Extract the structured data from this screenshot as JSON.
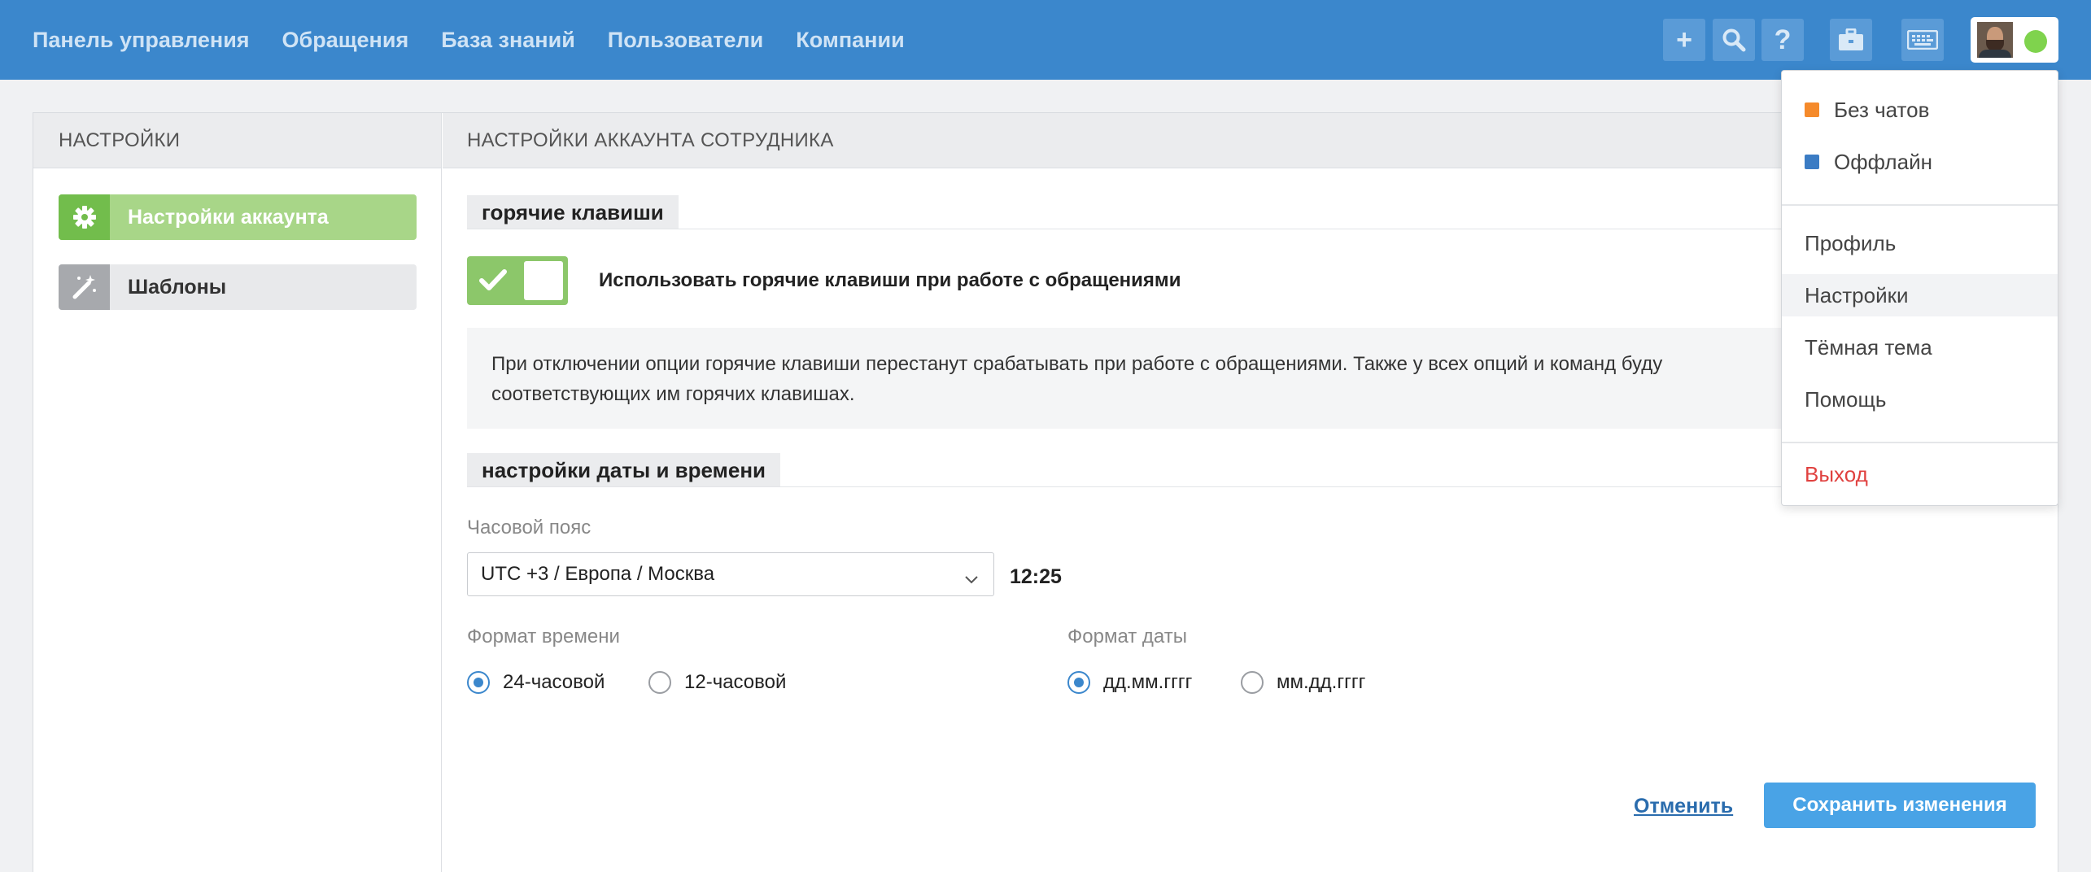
{
  "topnav": {
    "items": [
      "Панель управления",
      "Обращения",
      "База знаний",
      "Пользователи",
      "Компании"
    ]
  },
  "toolbar": {
    "icons": [
      "plus-icon",
      "search-icon",
      "help-icon",
      "briefcase-icon",
      "keyboard-icon"
    ],
    "plus_glyph": "+",
    "help_glyph": "?"
  },
  "user": {
    "status_color": "#7fd34d"
  },
  "sidebar": {
    "header": "НАСТРОЙКИ",
    "items": [
      {
        "label": "Настройки аккаунта",
        "icon": "gear-icon",
        "active": true
      },
      {
        "label": "Шаблоны",
        "icon": "magic-wand-icon",
        "active": false
      }
    ]
  },
  "content": {
    "header": "НАСТРОЙКИ АККАУНТА СОТРУДНИКА",
    "hotkeys": {
      "title": "горячие клавиши",
      "toggle_on": true,
      "toggle_label": "Использовать горячие клавиши при работе с обращениями",
      "note_line1": "При отключении опции горячие клавиши перестанут срабатывать при работе с обращениями. Также у всех опций и команд буду",
      "note_line2": "соответствующих им горячих клавишах."
    },
    "datetime": {
      "title": "настройки даты и времени",
      "timezone_label": "Часовой пояс",
      "timezone_value": "UTC +3 / Европа / Москва",
      "clock": "12:25",
      "time_format_label": "Формат времени",
      "time_formats": [
        {
          "label": "24-часовой",
          "selected": true
        },
        {
          "label": "12-часовой",
          "selected": false
        }
      ],
      "date_format_label": "Формат даты",
      "date_formats": [
        {
          "label": "дд.мм.гггг",
          "selected": true
        },
        {
          "label": "мм.дд.гггг",
          "selected": false
        }
      ]
    },
    "actions": {
      "cancel": "Отменить",
      "save": "Сохранить изменения"
    }
  },
  "menu": {
    "statuses": [
      {
        "label": "Без чатов",
        "color": "#f58a2b"
      },
      {
        "label": "Оффлайн",
        "color": "#3b7cc4"
      }
    ],
    "items": [
      "Профиль",
      "Настройки",
      "Тёмная тема",
      "Помощь"
    ],
    "highlighted": "Настройки",
    "logout": "Выход"
  }
}
